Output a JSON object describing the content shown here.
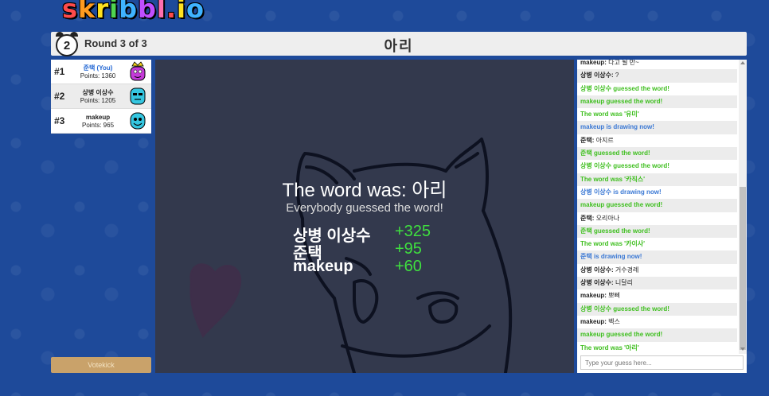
{
  "logo": "skribbl.io",
  "header": {
    "timer": "2",
    "round": "Round 3 of 3",
    "word": "아리"
  },
  "players": [
    {
      "rank": "#1",
      "name": "준택 (You)",
      "points": "Points: 1360",
      "is_you": true,
      "crown": true
    },
    {
      "rank": "#2",
      "name": "상병 이상수",
      "points": "Points: 1205",
      "is_you": false
    },
    {
      "rank": "#3",
      "name": "makeup",
      "points": "Points: 965",
      "is_you": false
    }
  ],
  "votekick_label": "Votekick",
  "overlay": {
    "word_was": "The word was: 아리",
    "subtitle": "Everybody guessed the word!",
    "scores": [
      {
        "name": "상병 이상수",
        "delta": "+325"
      },
      {
        "name": "준택",
        "delta": "+95"
      },
      {
        "name": "makeup",
        "delta": "+60"
      }
    ]
  },
  "chat": {
    "messages": [
      {
        "type": "normal",
        "user": "makeup:",
        "text": "다고 될 만~"
      },
      {
        "type": "normal",
        "user": "상병 이상수:",
        "text": "?"
      },
      {
        "type": "green",
        "text": "상병 이상수 guessed the word!"
      },
      {
        "type": "green",
        "text": "makeup guessed the word!"
      },
      {
        "type": "green",
        "text": "The word was '유미'"
      },
      {
        "type": "blue",
        "text": "makeup is drawing now!"
      },
      {
        "type": "normal",
        "user": "준택:",
        "text": "아지르"
      },
      {
        "type": "green",
        "text": "준택 guessed the word!"
      },
      {
        "type": "green",
        "text": "상병 이상수 guessed the word!"
      },
      {
        "type": "green",
        "text": "The word was '카직스'"
      },
      {
        "type": "blue",
        "text": "상병 이상수 is drawing now!"
      },
      {
        "type": "green",
        "text": "makeup guessed the word!"
      },
      {
        "type": "normal",
        "user": "준택:",
        "text": "오리아나"
      },
      {
        "type": "green",
        "text": "준택 guessed the word!"
      },
      {
        "type": "green",
        "text": "The word was '카이사'"
      },
      {
        "type": "blue",
        "text": "준택 is drawing now!"
      },
      {
        "type": "normal",
        "user": "상병 이상수:",
        "text": "거수경례"
      },
      {
        "type": "normal",
        "user": "상병 이상수:",
        "text": "니달리"
      },
      {
        "type": "normal",
        "user": "makeup:",
        "text": "뽀삐"
      },
      {
        "type": "green",
        "text": "상병 이상수 guessed the word!"
      },
      {
        "type": "normal",
        "user": "makeup:",
        "text": "벡스"
      },
      {
        "type": "green",
        "text": "makeup guessed the word!"
      },
      {
        "type": "green",
        "text": "The word was '아리'"
      }
    ],
    "input_placeholder": "Type your guess here..."
  },
  "colors": {
    "background": "#1e4a9a",
    "canvas": "#33394d",
    "guess_green": "#3fbf1f",
    "drawing_blue": "#3a78d4",
    "score_green": "#3fe03f"
  }
}
